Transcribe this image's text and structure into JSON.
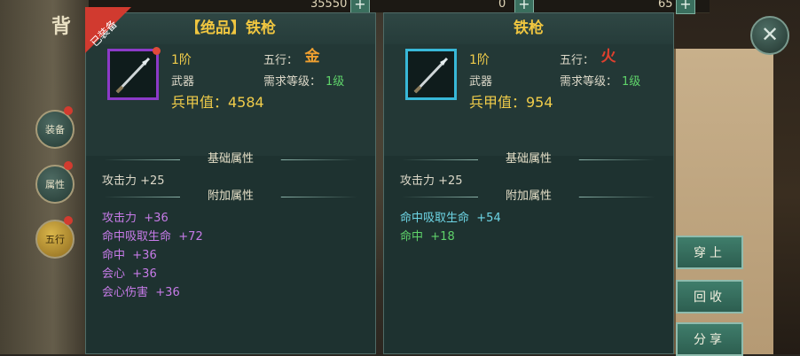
{
  "top_bar": {
    "value_a": "35550",
    "value_b": "0",
    "value_c": "65",
    "plus": "+"
  },
  "side_nav": {
    "back_char": "背",
    "items": [
      {
        "label": "装备"
      },
      {
        "label": "属性"
      },
      {
        "label": "五行"
      }
    ]
  },
  "left_panel": {
    "title": "【绝品】铁枪",
    "ribbon": "已装备",
    "stage": "1阶",
    "type": "武器",
    "element_label": "五行：",
    "element_glyph": "金",
    "element_color": "#f0a030",
    "level_req_label": "需求等级：",
    "level_req_value": "1级",
    "power_label": "兵甲值：4584",
    "base_section": "基础属性",
    "base_attrs": [
      {
        "text": "攻击力 +25"
      }
    ],
    "extra_section": "附加属性",
    "extra_attrs": [
      {
        "name": "攻击力",
        "value": "+36"
      },
      {
        "name": "命中吸取生命",
        "value": "+72"
      },
      {
        "name": "命中",
        "value": "+36"
      },
      {
        "name": "会心",
        "value": "+36"
      },
      {
        "name": "会心伤害",
        "value": "+36"
      }
    ],
    "frame_color": "#8c3ac8"
  },
  "right_panel": {
    "title": "铁枪",
    "stage": "1阶",
    "type": "武器",
    "element_label": "五行：",
    "element_glyph": "火",
    "element_color": "#e0402e",
    "level_req_label": "需求等级：",
    "level_req_value": "1级",
    "power_label": "兵甲值：954",
    "base_section": "基础属性",
    "base_attrs": [
      {
        "text": "攻击力 +25"
      }
    ],
    "extra_section": "附加属性",
    "extra_attrs": [
      {
        "name": "命中吸取生命",
        "value": "+54"
      },
      {
        "name": "命中",
        "value": "+18"
      }
    ],
    "frame_color": "#38b8d8"
  },
  "actions": {
    "equip": "穿上",
    "recycle": "回收",
    "share": "分享",
    "close": "✕"
  }
}
